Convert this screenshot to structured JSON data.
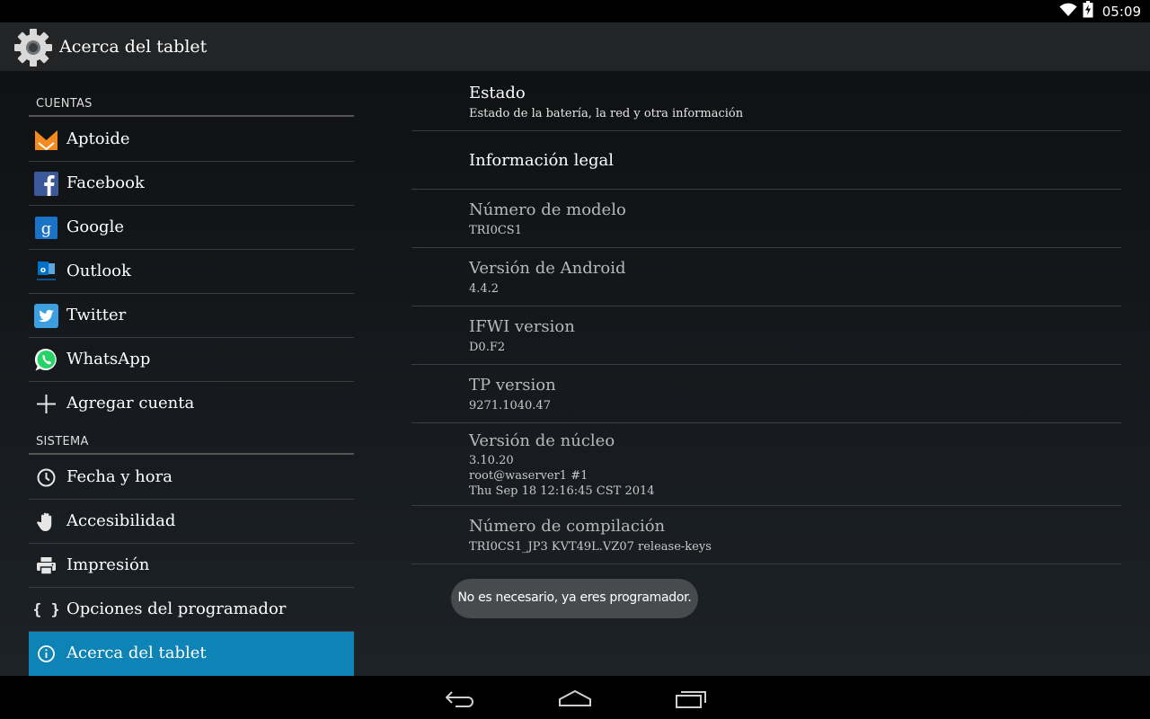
{
  "status_bar": {
    "time": "05:09",
    "wifi_icon": "wifi-icon",
    "battery_icon": "battery-charging-icon"
  },
  "action_bar": {
    "title": "Acerca del tablet",
    "icon": "settings-gear-icon"
  },
  "sidebar": {
    "sections": [
      {
        "header": "CUENTAS",
        "items": [
          {
            "label": "Aptoide",
            "icon": "aptoide-icon",
            "color": "#f28a1f"
          },
          {
            "label": "Facebook",
            "icon": "facebook-icon",
            "color": "#3b5998"
          },
          {
            "label": "Google",
            "icon": "google-icon",
            "color": "#1a73c7"
          },
          {
            "label": "Outlook",
            "icon": "outlook-icon",
            "color": "#0072c6"
          },
          {
            "label": "Twitter",
            "icon": "twitter-icon",
            "color": "#3d9ee0"
          },
          {
            "label": "WhatsApp",
            "icon": "whatsapp-icon",
            "color": "#25d366"
          },
          {
            "label": "Agregar cuenta",
            "icon": "plus-icon"
          }
        ]
      },
      {
        "header": "SISTEMA",
        "items": [
          {
            "label": "Fecha y hora",
            "icon": "clock-icon"
          },
          {
            "label": "Accesibilidad",
            "icon": "hand-icon"
          },
          {
            "label": "Impresión",
            "icon": "printer-icon"
          },
          {
            "label": "Opciones del programador",
            "icon": "braces-icon"
          },
          {
            "label": "Acerca del tablet",
            "icon": "info-icon",
            "selected": true
          }
        ]
      }
    ],
    "selected_color": "#0e84b6"
  },
  "detail": {
    "rows": [
      {
        "title": "Estado",
        "lines": [
          "Estado de la batería, la red y otra información"
        ],
        "enabled": true
      },
      {
        "title": "Información legal",
        "lines": [],
        "enabled": true
      },
      {
        "title": "Número de modelo",
        "lines": [
          "TRI0CS1"
        ],
        "enabled": false
      },
      {
        "title": "Versión de Android",
        "lines": [
          "4.4.2"
        ],
        "enabled": false
      },
      {
        "title": "IFWI version",
        "lines": [
          "D0.F2"
        ],
        "enabled": false
      },
      {
        "title": "TP version",
        "lines": [
          "9271.1040.47"
        ],
        "enabled": false
      },
      {
        "title": "Versión de núcleo",
        "lines": [
          "3.10.20",
          "root@waserver1 #1",
          "Thu Sep 18 12:16:45 CST 2014"
        ],
        "enabled": false
      },
      {
        "title": "Número de compilación",
        "lines": [
          "TRI0CS1_JP3 KVT49L.VZ07 release-keys"
        ],
        "enabled": false
      }
    ]
  },
  "toast": {
    "message": "No es necesario, ya eres programador."
  },
  "nav_bar": {
    "back_icon": "back-icon",
    "home_icon": "home-icon",
    "recents_icon": "recent-apps-icon"
  }
}
